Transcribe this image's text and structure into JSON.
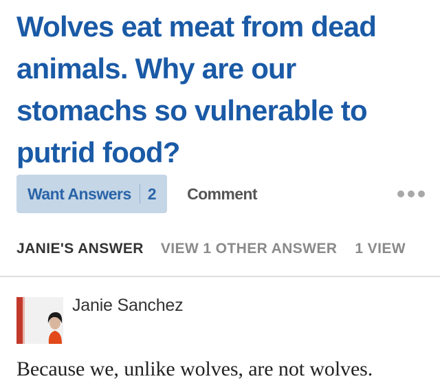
{
  "question": {
    "title": "Wolves eat meat from dead animals. Why are our stomachs so vulnerable to putrid food?"
  },
  "actions": {
    "want_answers_label": "Want Answers",
    "want_answers_count": "2",
    "comment_label": "Comment",
    "more_icon": "more-horizontal-icon"
  },
  "tabs": {
    "current": "JANIE'S ANSWER",
    "other": "VIEW 1 OTHER ANSWER",
    "views": "1 VIEW"
  },
  "answer": {
    "author": "Janie Sanchez",
    "text": "Because we, unlike wolves, are not wolves."
  },
  "colors": {
    "title": "#1a5aa6",
    "button_bg": "#c5d6e6",
    "button_text": "#2a64a8"
  }
}
